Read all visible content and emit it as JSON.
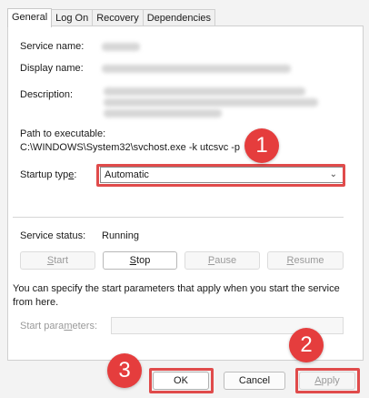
{
  "tabs": [
    "General",
    "Log On",
    "Recovery",
    "Dependencies"
  ],
  "labels": {
    "service_name": "Service name:",
    "display_name": "Display name:",
    "description": "Description:",
    "path_label": "Path to executable:",
    "path_value": "C:\\WINDOWS\\System32\\svchost.exe -k utcsvc -p",
    "startup_type_pre": "Startup typ",
    "startup_type_u": "e",
    "startup_type_post": ":",
    "service_status": "Service status:",
    "status_value": "Running",
    "help_text": "You can specify the start parameters that apply when you start the service from here.",
    "start_parameters": "Start para",
    "start_parameters_u": "m",
    "start_parameters_post": "eters:"
  },
  "startup": {
    "selected": "Automatic"
  },
  "service_buttons": {
    "start": {
      "u": "S",
      "rest": "tart"
    },
    "stop": {
      "u": "S",
      "rest": "top"
    },
    "pause": {
      "u": "P",
      "rest": "ause"
    },
    "resume": {
      "u": "R",
      "rest": "esume"
    }
  },
  "dialog_buttons": {
    "ok": "OK",
    "cancel": "Cancel",
    "apply_u": "A",
    "apply_rest": "pply"
  },
  "annotations": [
    "1",
    "2",
    "3"
  ],
  "colors": {
    "annotation": "#e53d3d",
    "highlight_border": "#e04b4b"
  }
}
